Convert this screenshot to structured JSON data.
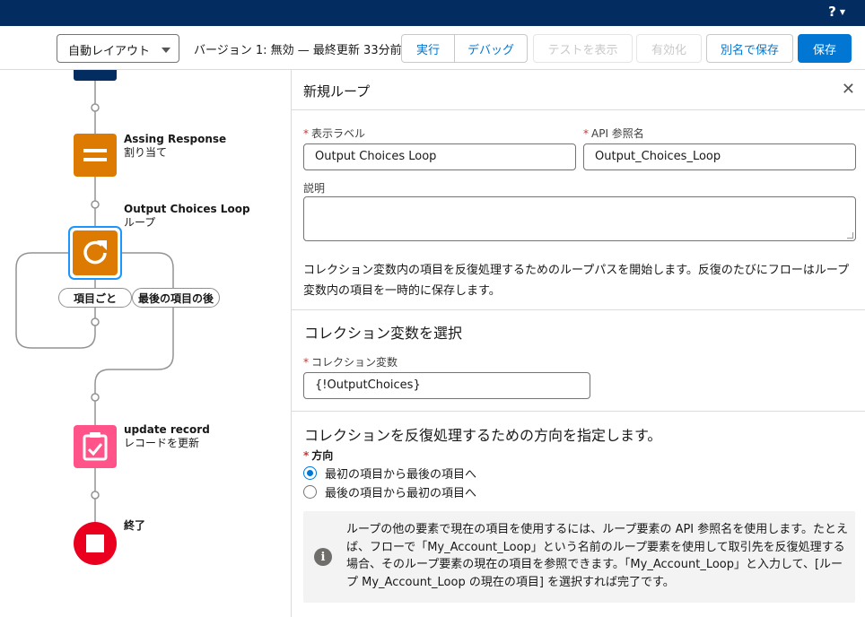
{
  "header": {
    "help_label": "?"
  },
  "toolbar": {
    "layout_select": "自動レイアウト",
    "version_text": "バージョン 1: 無効 — 最終更新 33分前",
    "run_label": "実行",
    "debug_label": "デバッグ",
    "test_label": "テストを表示",
    "activate_label": "有効化",
    "save_as_label": "別名で保存",
    "save_label": "保存"
  },
  "canvas": {
    "assignment": {
      "title": "Assing Response",
      "subtitle": "割り当て"
    },
    "loop": {
      "title": "Output Choices Loop",
      "subtitle": "ループ"
    },
    "branch_each": "項目ごと",
    "branch_after": "最後の項目の後",
    "update": {
      "title": "update record",
      "subtitle": "レコードを更新"
    },
    "end": {
      "title": "終了"
    }
  },
  "panel": {
    "title": "新規ループ",
    "label_field": {
      "label": "表示ラベル",
      "value": "Output Choices Loop"
    },
    "api_field": {
      "label": "API 参照名",
      "value": "Output_Choices_Loop"
    },
    "description_label": "説明",
    "description_text": "コレクション変数内の項目を反復処理するためのループパスを開始します。反復のたびにフローはループ変数内の項目を一時的に保存します。",
    "collection_section_title": "コレクション変数を選択",
    "collection_field": {
      "label": "コレクション変数",
      "value": "{!OutputChoices}"
    },
    "direction_section_title": "コレクションを反復処理するための方向を指定します。",
    "direction_label": "方向",
    "direction_options": [
      "最初の項目から最後の項目へ",
      "最後の項目から最初の項目へ"
    ],
    "info_text": "ループの他の要素で現在の項目を使用するには、ループ要素の API 参照名を使用します。たとえば、フローで「My_Account_Loop」という名前のループ要素を使用して取引先を反復処理する場合、そのループ要素の現在の項目を参照できます。「My_Account_Loop」と入力して、[ループ My_Account_Loop の現在の項目] を選択すれば完了です。"
  },
  "colors": {
    "header_bg": "#032d60",
    "brand_blue": "#0176d3",
    "assignment_orange": "#dd7a01",
    "update_pink": "#ff538a",
    "end_red": "#ea001e"
  }
}
